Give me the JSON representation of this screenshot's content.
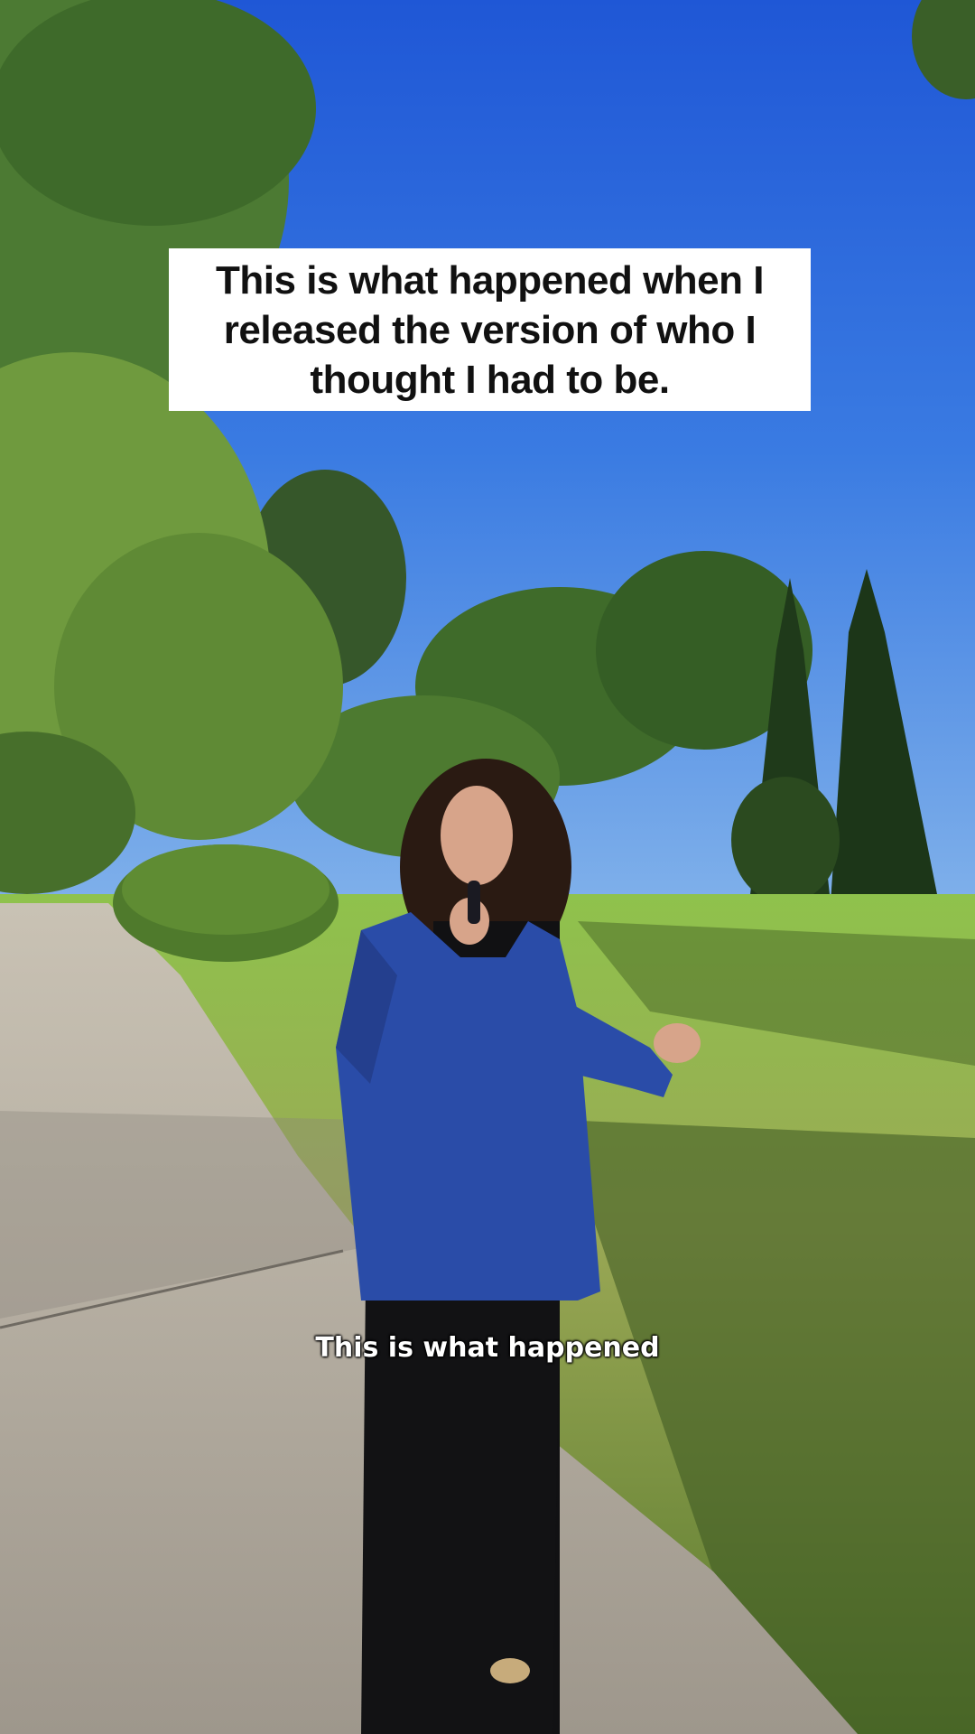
{
  "video": {
    "headline": "This is what happened when I released the version of who I thought I had to be.",
    "caption": "This is what happened"
  },
  "colors": {
    "sky": "#2f6bd8",
    "jacket": "#2a4ca8",
    "grass": "#8fb54a",
    "path": "#b9b3a8"
  }
}
